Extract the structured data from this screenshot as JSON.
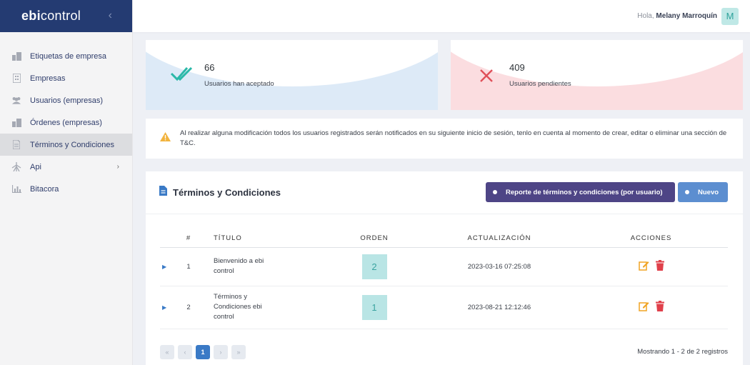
{
  "brand": {
    "logo_prefix": "ebi",
    "logo_suffix": "control"
  },
  "header": {
    "greeting": "Hola,",
    "user_name": "Melany Marroquín",
    "avatar_letter": "M"
  },
  "sidebar": {
    "items": [
      {
        "label": "Etiquetas de empresa",
        "icon": "building-icon"
      },
      {
        "label": "Empresas",
        "icon": "office-icon"
      },
      {
        "label": "Usuarios (empresas)",
        "icon": "users-icon"
      },
      {
        "label": "Órdenes (empresas)",
        "icon": "building-icon"
      },
      {
        "label": "Términos y Condiciones",
        "icon": "document-icon",
        "active": true
      },
      {
        "label": "Api",
        "icon": "api-icon",
        "has_submenu": true
      },
      {
        "label": "Bitacora",
        "icon": "chart-icon"
      }
    ]
  },
  "stats": {
    "accepted": {
      "value": "66",
      "label": "Usuarios han aceptado",
      "icon": "double-check-icon"
    },
    "pending": {
      "value": "409",
      "label": "Usuarios pendientes",
      "icon": "x-icon"
    }
  },
  "alert": {
    "text": "Al realizar alguna modificación todos los usuarios registrados serán notificados en su siguiente inicio de sesión, tenlo en cuenta al momento de crear, editar o eliminar una sección de T&C.",
    "icon": "warning-icon"
  },
  "panel": {
    "title": "Términos y Condiciones",
    "report_button": "Reporte de términos y condiciones (por usuario)",
    "new_button": "Nuevo"
  },
  "table": {
    "headers": [
      "#",
      "TÍTULO",
      "ORDEN",
      "ACTUALIZACIÓN",
      "ACCIONES"
    ],
    "rows": [
      {
        "num": "1",
        "title": "Bienvenido a ebi control",
        "order": "2",
        "updated": "2023-03-16 07:25:08"
      },
      {
        "num": "2",
        "title": "Términos y Condiciones ebi control",
        "order": "1",
        "updated": "2023-08-21 12:12:46"
      }
    ]
  },
  "pagination": {
    "first": "«",
    "prev": "‹",
    "current": "1",
    "next": "›",
    "last": "»",
    "summary": "Mostrando 1 - 2 de 2 registros"
  },
  "colors": {
    "brand_bg": "#243b72",
    "accent": "#3a7ac6",
    "report_btn": "#4e4586",
    "new_btn": "#5c8ed0",
    "check": "#2bb8a8",
    "cross": "#e0505a",
    "warn": "#f2b33d",
    "edit": "#f0a424",
    "delete": "#e0404a"
  }
}
